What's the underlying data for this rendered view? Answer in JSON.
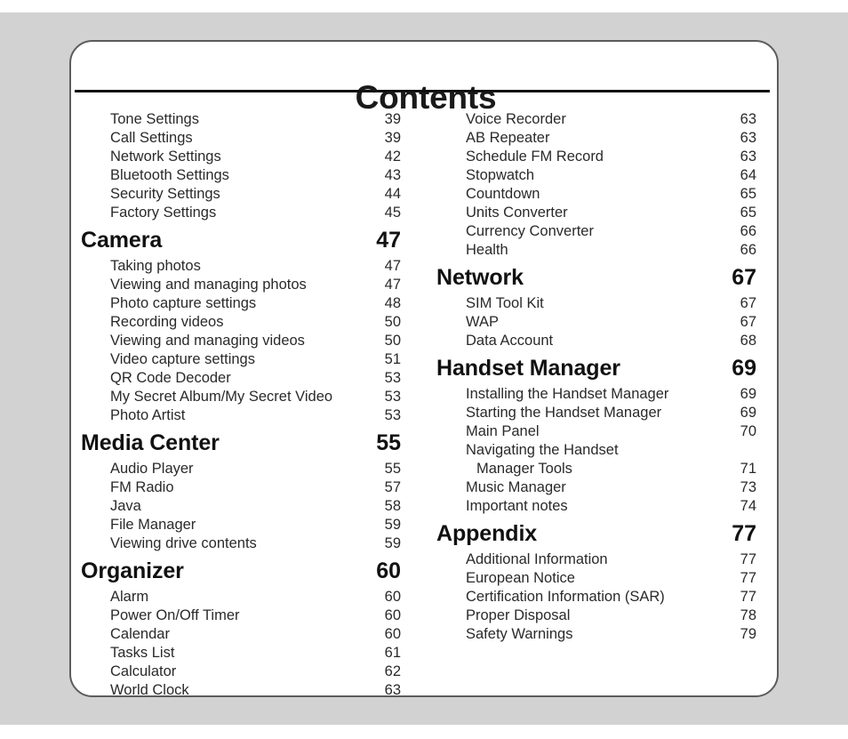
{
  "document": {
    "title": "Contents",
    "page_background": "#d2d2d2",
    "page_surface": "#ffffff",
    "border_color": "#5c5c5c",
    "text_color": "#2a2a2a",
    "heading_color": "#111111"
  },
  "columns": [
    {
      "name": "left-column",
      "rows": [
        {
          "type": "entry",
          "label": "Tone Settings",
          "page": "39"
        },
        {
          "type": "entry",
          "label": "Call Settings",
          "page": "39"
        },
        {
          "type": "entry",
          "label": "Network Settings",
          "page": "42"
        },
        {
          "type": "entry",
          "label": "Bluetooth Settings",
          "page": "43"
        },
        {
          "type": "entry",
          "label": "Security Settings",
          "page": "44"
        },
        {
          "type": "entry",
          "label": "Factory Settings",
          "page": "45"
        },
        {
          "type": "chapter",
          "label": "Camera",
          "page": "47"
        },
        {
          "type": "entry",
          "label": "Taking photos",
          "page": "47"
        },
        {
          "type": "entry",
          "label": "Viewing and managing photos",
          "page": "47"
        },
        {
          "type": "entry",
          "label": "Photo capture settings",
          "page": "48"
        },
        {
          "type": "entry",
          "label": "Recording videos",
          "page": "50"
        },
        {
          "type": "entry",
          "label": "Viewing and managing videos",
          "page": "50"
        },
        {
          "type": "entry",
          "label": "Video capture settings",
          "page": "51"
        },
        {
          "type": "entry",
          "label": "QR Code Decoder",
          "page": "53"
        },
        {
          "type": "entry",
          "label": "My Secret Album/My Secret Video",
          "page": "53"
        },
        {
          "type": "entry",
          "label": "Photo Artist",
          "page": "53"
        },
        {
          "type": "chapter",
          "label": "Media Center",
          "page": "55"
        },
        {
          "type": "entry",
          "label": "Audio Player",
          "page": "55"
        },
        {
          "type": "entry",
          "label": "FM Radio",
          "page": "57"
        },
        {
          "type": "entry",
          "label": "Java",
          "page": "58"
        },
        {
          "type": "entry",
          "label": "File Manager",
          "page": "59"
        },
        {
          "type": "entry",
          "label": "Viewing drive contents",
          "page": "59"
        },
        {
          "type": "chapter",
          "label": "Organizer",
          "page": "60"
        },
        {
          "type": "entry",
          "label": "Alarm",
          "page": "60"
        },
        {
          "type": "entry",
          "label": "Power On/Off Timer",
          "page": "60"
        },
        {
          "type": "entry",
          "label": "Calendar",
          "page": "60"
        },
        {
          "type": "entry",
          "label": "Tasks List",
          "page": "61"
        },
        {
          "type": "entry",
          "label": "Calculator",
          "page": "62"
        },
        {
          "type": "entry",
          "label": "World Clock",
          "page": "63"
        }
      ]
    },
    {
      "name": "right-column",
      "rows": [
        {
          "type": "entry",
          "label": "Voice Recorder",
          "page": "63"
        },
        {
          "type": "entry",
          "label": "AB Repeater",
          "page": "63"
        },
        {
          "type": "entry",
          "label": "Schedule FM Record",
          "page": "63"
        },
        {
          "type": "entry",
          "label": "Stopwatch",
          "page": "64"
        },
        {
          "type": "entry",
          "label": "Countdown",
          "page": "65"
        },
        {
          "type": "entry",
          "label": "Units Converter",
          "page": "65"
        },
        {
          "type": "entry",
          "label": "Currency Converter",
          "page": "66"
        },
        {
          "type": "entry",
          "label": "Health",
          "page": "66"
        },
        {
          "type": "chapter",
          "label": "Network",
          "page": "67"
        },
        {
          "type": "entry",
          "label": "SIM Tool Kit",
          "page": "67"
        },
        {
          "type": "entry",
          "label": "WAP",
          "page": "67"
        },
        {
          "type": "entry",
          "label": "Data Account",
          "page": "68"
        },
        {
          "type": "chapter",
          "label": "Handset Manager",
          "page": "69"
        },
        {
          "type": "entry",
          "label": "Installing the Handset Manager",
          "page": "69"
        },
        {
          "type": "entry",
          "label": "Starting the Handset Manager",
          "page": "69"
        },
        {
          "type": "entry",
          "label": "Main Panel",
          "page": "70"
        },
        {
          "type": "entry",
          "label": "Navigating the Handset",
          "page": "",
          "nonum": true
        },
        {
          "type": "entry",
          "label": "Manager Tools",
          "page": "71",
          "indent2": true
        },
        {
          "type": "entry",
          "label": "Music Manager",
          "page": "73"
        },
        {
          "type": "entry",
          "label": "Important notes",
          "page": "74"
        },
        {
          "type": "chapter",
          "label": "Appendix",
          "page": "77"
        },
        {
          "type": "entry",
          "label": "Additional Information",
          "page": "77"
        },
        {
          "type": "entry",
          "label": "European Notice",
          "page": "77"
        },
        {
          "type": "entry",
          "label": "Certification Information (SAR)",
          "page": "77"
        },
        {
          "type": "entry",
          "label": "Proper Disposal",
          "page": "78"
        },
        {
          "type": "entry",
          "label": "Safety Warnings",
          "page": "79"
        }
      ]
    }
  ]
}
